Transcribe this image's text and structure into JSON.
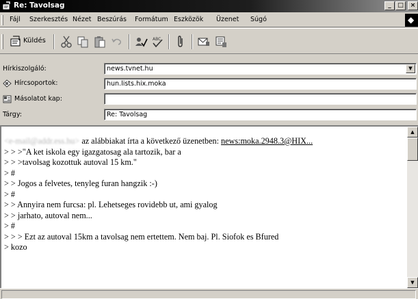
{
  "window": {
    "title": "Re: Tavolsag",
    "caption_buttons": {
      "minimize": "_",
      "maximize": "□",
      "close": "×"
    }
  },
  "menu": {
    "items": [
      "Fájl",
      "Szerkesztés",
      "Nézet",
      "Beszúrás",
      "Formátum",
      "Eszközök",
      "Üzenet",
      "Súgó"
    ]
  },
  "toolbar": {
    "send_label": "Küldés",
    "icons": [
      "send-icon",
      "cut-icon",
      "copy-icon",
      "paste-icon",
      "undo-icon",
      "check-names-icon",
      "spelling-icon",
      "attach-icon",
      "priority-icon",
      "sign-icon"
    ]
  },
  "header": {
    "server_label": "Hírkiszolgáló:",
    "server_value": "news.tvnet.hu",
    "newsgroups_label": "Hírcsoportok:",
    "newsgroups_value": "hun.lists.hix.moka",
    "cc_label": "Másolatot kap:",
    "cc_value": "",
    "subject_label": "Tárgy:",
    "subject_value": "Re: Tavolsag"
  },
  "body": {
    "intro_sender": "<e-mail@addr.ess.hu>",
    "intro_text": " az alábbiakat írta a következő üzenetben: ",
    "intro_link": "news:moka.2948.3@HIX...",
    "lines": [
      "> > >\"A ket iskola egy igazgatosag ala tartozik, bar a",
      "> > >tavolsag kozottuk autoval 15 km.\"",
      "> #",
      "> > Jogos a felvetes, tenyleg furan hangzik :-)",
      "> #",
      "> > Annyira nem furcsa: pl. Lehetseges rovidebb ut, ami gyalog",
      "> > jarhato, autoval nem...",
      "> #",
      "> > > Ezt az autoval 15km a tavolsag nem ertettem. Nem baj. Pl. Siofok es Bfured",
      "> kozo"
    ]
  },
  "scrollbar": {
    "up": "▲",
    "down": "▼",
    "position_fraction": 0.0
  },
  "status": {
    "text": ""
  }
}
